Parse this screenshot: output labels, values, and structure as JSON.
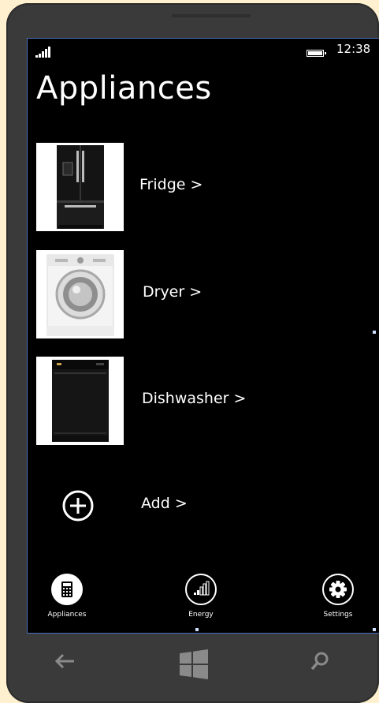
{
  "status_bar": {
    "time": "12:38",
    "signal_icon": "signal-bars-icon",
    "battery_icon": "battery-icon"
  },
  "page": {
    "title": "Appliances"
  },
  "appliances": [
    {
      "label": "Fridge >",
      "icon": "fridge-image"
    },
    {
      "label": "Dryer >",
      "icon": "dryer-image"
    },
    {
      "label": "Dishwasher >",
      "icon": "dishwasher-image"
    }
  ],
  "add": {
    "label": "Add >",
    "icon": "plus-circle-icon"
  },
  "bottom_nav": {
    "items": [
      {
        "label": "Appliances",
        "icon": "calculator-icon",
        "selected": true
      },
      {
        "label": "Energy",
        "icon": "energy-bars-icon",
        "selected": false
      },
      {
        "label": "Settings",
        "icon": "gear-icon",
        "selected": false
      }
    ]
  },
  "hardware_keys": {
    "back_icon": "back-arrow-icon",
    "start_icon": "windows-logo-icon",
    "search_icon": "search-icon"
  },
  "colors": {
    "screen_bg": "#000000",
    "text": "#ffffff",
    "phone_body": "#3a3a3a",
    "background": "#fff1cf",
    "selection_border": "#4a6fbf"
  }
}
